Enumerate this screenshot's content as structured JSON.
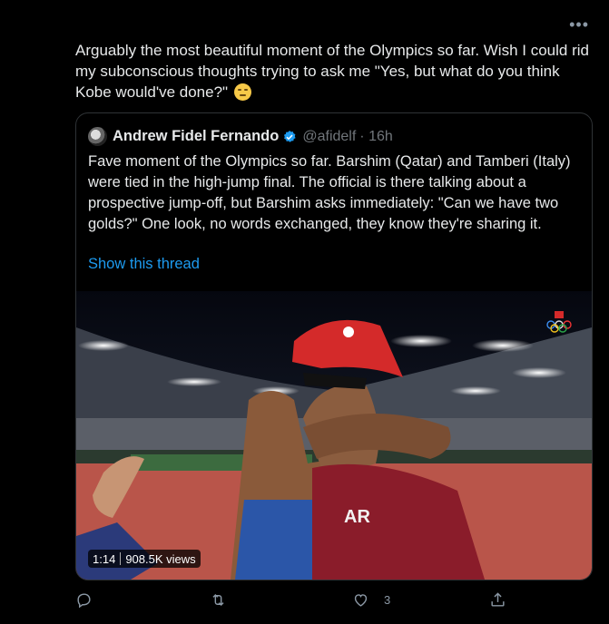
{
  "tweet": {
    "text": "Arguably the most beautiful moment of the Olympics so far. Wish I could rid my subconscious thoughts trying to ask me \"Yes, but what do you think Kobe would've done?\""
  },
  "quote": {
    "name": "Andrew Fidel Fernando",
    "handle": "@afidelf",
    "time": "· 16h",
    "text": "Fave moment of the Olympics so far. Barshim (Qatar) and Tamberi (Italy) were tied in the high-jump final. The official is there talking about a prospective jump-off, but Barshim asks immediately: \"Can we have two golds?\" One look, no words exchanged, they know they're sharing it.",
    "show_thread": "Show this thread"
  },
  "video": {
    "duration": "1:14",
    "views": "908.5K views",
    "shirt_text": "AR"
  },
  "actions": {
    "reply_count": "",
    "retweet_count": "",
    "like_count": "3"
  },
  "colors": {
    "background": "#000000",
    "link": "#1d9bf0",
    "muted": "#71767b",
    "verified": "#1d9bf0"
  }
}
